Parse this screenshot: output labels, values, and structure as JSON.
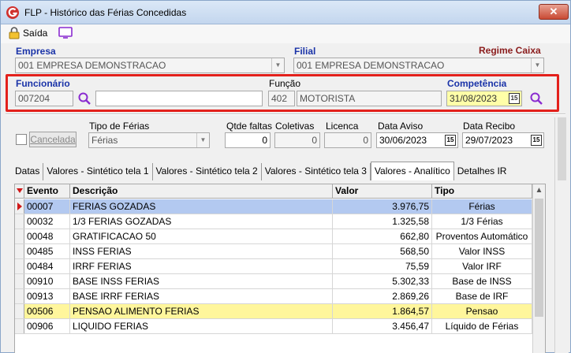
{
  "window": {
    "title": "FLP - Histórico das Férias Concedidas",
    "close_symbol": "✕",
    "accent_color": "#e3201b"
  },
  "toolbar": {
    "exit_label": "Saída"
  },
  "header": {
    "empresa_label": "Empresa",
    "empresa_value": "001 EMPRESA DEMONSTRACAO",
    "filial_label": "Filial",
    "filial_value": "001 EMPRESA DEMONSTRACAO",
    "regime_label": "Regime Caixa"
  },
  "employee": {
    "funcionario_label": "Funcionário",
    "funcionario_code": "007204",
    "funcionario_name": "",
    "funcao_label": "Função",
    "funcao_code": "402",
    "funcao_name": "MOTORISTA",
    "competencia_label": "Competência",
    "competencia_value": "31/08/2023"
  },
  "details": {
    "cancelada_label": "Cancelada",
    "tipo_ferias_label": "Tipo de Férias",
    "tipo_ferias_value": "Férias",
    "qtde_faltas_label": "Qtde faltas",
    "qtde_faltas_value": "0",
    "coletivas_label": "Coletivas",
    "coletivas_value": "0",
    "licenca_label": "Licenca",
    "licenca_value": "0",
    "data_aviso_label": "Data Aviso",
    "data_aviso_value": "30/06/2023",
    "data_recibo_label": "Data Recibo",
    "data_recibo_value": "29/07/2023",
    "calendar_glyph": "15"
  },
  "tabs": [
    {
      "label": "Datas"
    },
    {
      "label": "Valores - Sintético tela 1"
    },
    {
      "label": "Valores - Sintético tela 2"
    },
    {
      "label": "Valores - Sintético tela 3"
    },
    {
      "label": "Valores - Analítico"
    },
    {
      "label": "Detalhes IR"
    }
  ],
  "grid": {
    "columns": [
      "Evento",
      "Descrição",
      "Valor",
      "Tipo"
    ],
    "rows": [
      {
        "evento": "00007",
        "descricao": "FERIAS GOZADAS",
        "valor": "3.976,75",
        "tipo": "Férias",
        "state": "selected"
      },
      {
        "evento": "00032",
        "descricao": "1/3 FERIAS GOZADAS",
        "valor": "1.325,58",
        "tipo": "1/3 Férias",
        "state": ""
      },
      {
        "evento": "00048",
        "descricao": "GRATIFICACAO 50",
        "valor": "662,80",
        "tipo": "Proventos Automático",
        "state": ""
      },
      {
        "evento": "00485",
        "descricao": "INSS FERIAS",
        "valor": "568,50",
        "tipo": "Valor INSS",
        "state": ""
      },
      {
        "evento": "00484",
        "descricao": "IRRF FERIAS",
        "valor": "75,59",
        "tipo": "Valor IRF",
        "state": ""
      },
      {
        "evento": "00910",
        "descricao": "BASE INSS FERIAS",
        "valor": "5.302,33",
        "tipo": "Base de INSS",
        "state": ""
      },
      {
        "evento": "00913",
        "descricao": "BASE IRRF FERIAS",
        "valor": "2.869,26",
        "tipo": "Base de IRF",
        "state": ""
      },
      {
        "evento": "00506",
        "descricao": "PENSAO ALIMENTO FERIAS",
        "valor": "1.864,57",
        "tipo": "Pensao",
        "state": "highlighted"
      },
      {
        "evento": "00906",
        "descricao": "LIQUIDO FERIAS",
        "valor": "3.456,47",
        "tipo": "Líquido de Férias",
        "state": ""
      }
    ]
  }
}
